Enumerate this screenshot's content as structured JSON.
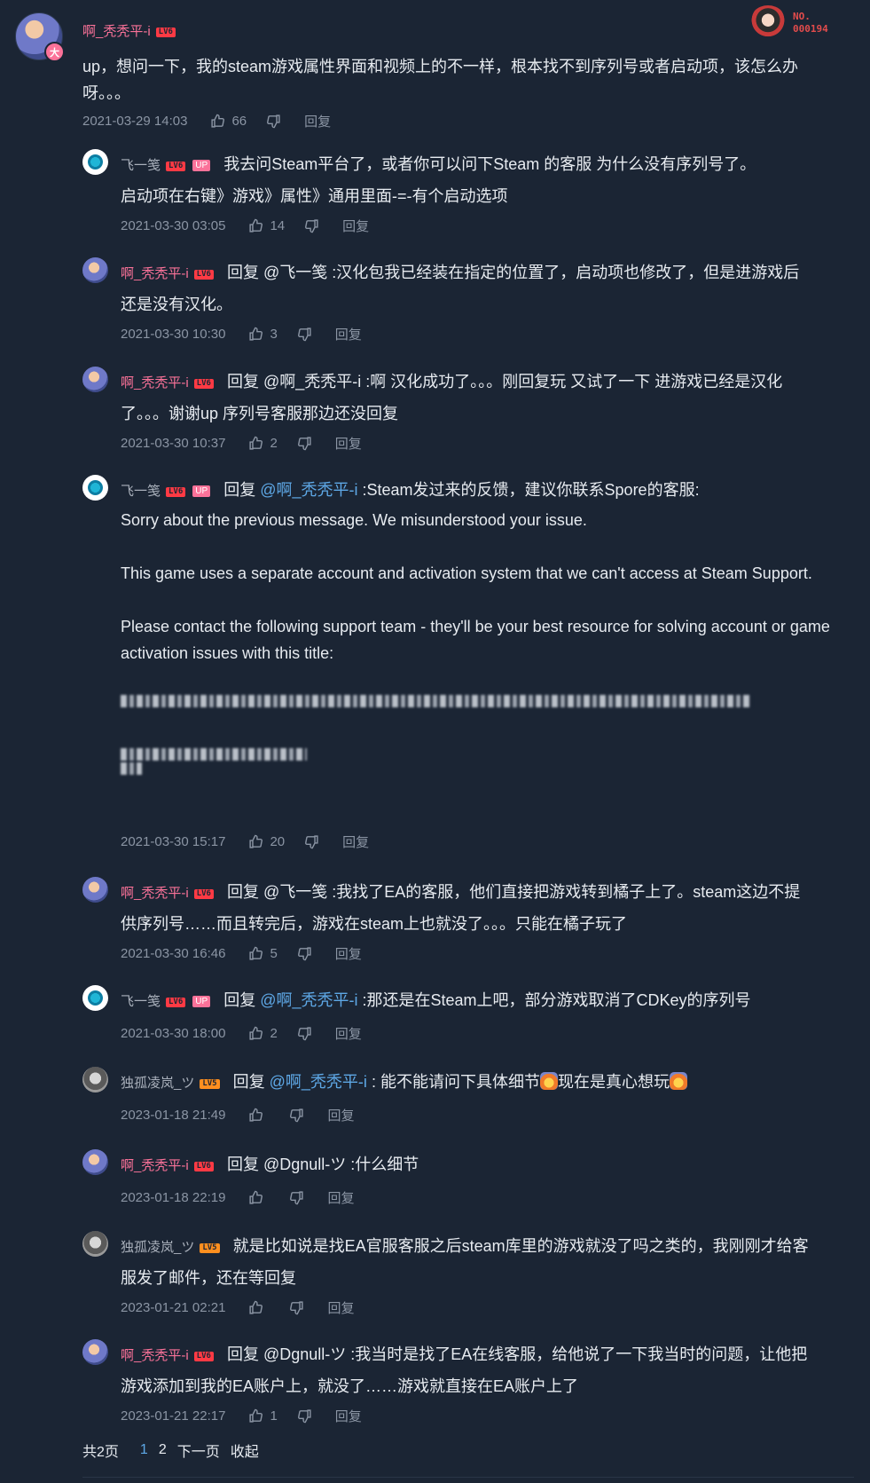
{
  "main": {
    "user": "啊_秃秃平-i",
    "level": "LV6",
    "vip_badge": "大",
    "text": "up，想问一下，我的steam游戏属性界面和视频上的不一样，根本找不到序列号或者启动项，该怎么办呀。。。",
    "time": "2021-03-29 14:03",
    "likes": "66",
    "reply_label": "回复"
  },
  "decoration": {
    "number_label": "NO.",
    "number": "000194"
  },
  "replies": [
    {
      "user": "飞一笺",
      "level": "LV6",
      "up": "UP",
      "prefix": "",
      "at": "",
      "text": "我去问Steam平台了，或者你可以问下Steam 的客服 为什么没有序列号了。",
      "text2": "启动项在右键》游戏》属性》通用里面-=-有个启动选项",
      "time": "2021-03-30 03:05",
      "likes": "14",
      "reply": "回复"
    },
    {
      "user": "啊_秃秃平-i",
      "level": "LV6",
      "prefix": "回复",
      "at": "@飞一笺",
      "text": ":汉化包我已经装在指定的位置了，启动项也修改了，但是进游戏后",
      "text2": "还是没有汉化。",
      "time": "2021-03-30 10:30",
      "likes": "3",
      "reply": "回复"
    },
    {
      "user": "啊_秃秃平-i",
      "level": "LV6",
      "prefix": "回复",
      "at": "@啊_秃秃平-i",
      "text": ":啊 汉化成功了。。。刚回复玩 又试了一下 进游戏已经是汉化",
      "text2": "了。。。谢谢up 序列号客服那边还没回复",
      "time": "2021-03-30 10:37",
      "likes": "2",
      "reply": "回复"
    },
    {
      "user": "飞一笺",
      "level": "LV6",
      "up": "UP",
      "prefix": "回复",
      "at": "@啊_秃秃平-i",
      "text": ":Steam发过来的反馈，建议你联系Spore的客服:",
      "p1": "Sorry about the previous message. We misunderstood your issue.",
      "p2": "This game uses a separate account and activation system that we can't access at Steam Support.",
      "p3": "Please contact the following support team - they'll be your best resource for solving account or game activation issues with this title:",
      "time": "2021-03-30 15:17",
      "likes": "20",
      "reply": "回复"
    },
    {
      "user": "啊_秃秃平-i",
      "level": "LV6",
      "prefix": "回复",
      "at": "@飞一笺",
      "text": ":我找了EA的客服，他们直接把游戏转到橘子上了。steam这边不提",
      "text2": "供序列号……而且转完后，游戏在steam上也就没了。。。只能在橘子玩了",
      "time": "2021-03-30 16:46",
      "likes": "5",
      "reply": "回复"
    },
    {
      "user": "飞一笺",
      "level": "LV6",
      "up": "UP",
      "prefix": "回复",
      "at": "@啊_秃秃平-i",
      "text": ":那还是在Steam上吧，部分游戏取消了CDKey的序列号",
      "time": "2021-03-30 18:00",
      "likes": "2",
      "reply": "回复"
    },
    {
      "user": "独孤凌岚_ツ",
      "level": "LV5",
      "prefix": "回复",
      "at": "@啊_秃秃平-i",
      "text": ": 能不能请问下具体细节",
      "text_mid": "现在是真心想玩",
      "time": "2023-01-18 21:49",
      "likes": "",
      "reply": "回复"
    },
    {
      "user": "啊_秃秃平-i",
      "level": "LV6",
      "prefix": "回复",
      "at": "@Dgnull-ツ",
      "text": ":什么细节",
      "time": "2023-01-18 22:19",
      "likes": "",
      "reply": "回复"
    },
    {
      "user": "独孤凌岚_ツ",
      "level": "LV5",
      "prefix": "",
      "at": "",
      "text": "就是比如说是找EA官服客服之后steam库里的游戏就没了吗之类的，我刚刚才给客",
      "text2": "服发了邮件，还在等回复",
      "time": "2023-01-21 02:21",
      "likes": "",
      "reply": "回复"
    },
    {
      "user": "啊_秃秃平-i",
      "level": "LV6",
      "prefix": "回复",
      "at": "@Dgnull-ツ",
      "text": ":我当时是找了EA在线客服，给他说了一下我当时的问题，让他把",
      "text2": "游戏添加到我的EA账户上，就没了……游戏就直接在EA账户上了",
      "time": "2023-01-21 22:17",
      "likes": "1",
      "reply": "回复"
    }
  ],
  "pager": {
    "total": "共2页",
    "page1": "1",
    "page2": "2",
    "next": "下一页",
    "collapse": "收起"
  }
}
